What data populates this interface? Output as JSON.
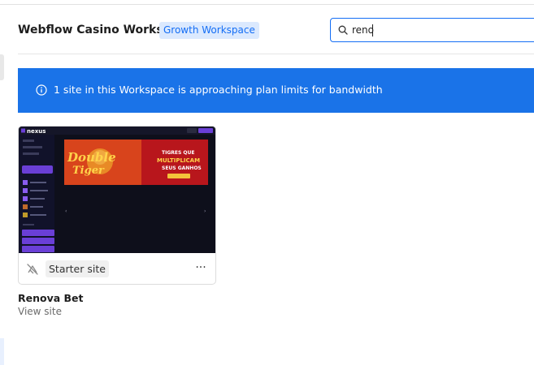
{
  "header": {
    "workspace_title": "Webflow Casino Works...",
    "plan_badge": "Growth Workspace",
    "search": {
      "value": "reno",
      "icon": "search-icon"
    }
  },
  "banner": {
    "icon": "info-icon",
    "message": "1 site in this Workspace is approaching plan limits for bandwidth",
    "color": "#1a73e8"
  },
  "site_card": {
    "thumbnail": {
      "brand": "nexus",
      "hero_script": "Double Tiger",
      "hero_text": "TIGRES QUE MULTIPLICAM SEUS GANHOS"
    },
    "status_icon": "unpublished-icon",
    "plan": "Starter site",
    "more_icon": "more-options-icon",
    "more_glyph": "···",
    "name": "Renova Bet",
    "link": "View site"
  },
  "colors": {
    "accent": "#146ef5",
    "badge_bg": "#dbe9fe",
    "thumb_bg": "#0e0f1b",
    "thumb_purple": "#6a3fd6"
  }
}
